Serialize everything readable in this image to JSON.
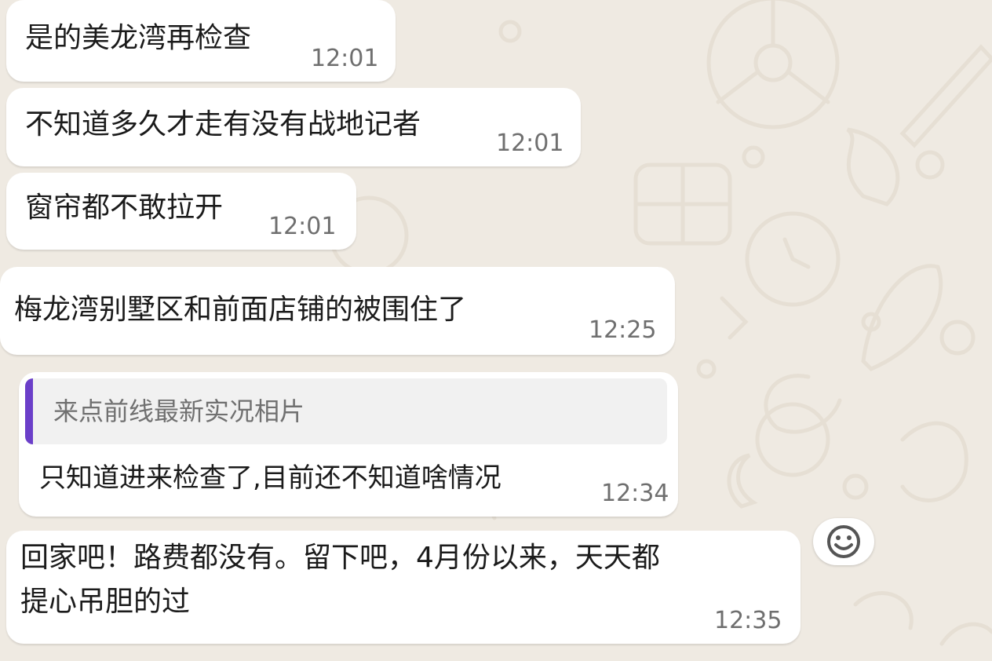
{
  "colors": {
    "chat_background": "#efeae2",
    "bubble_background": "#ffffff",
    "quote_accent": "#6b3fc9",
    "quote_background": "#f1f1f1",
    "time_text": "#6f6f6f"
  },
  "messages": [
    {
      "text": "是的美龙湾再检查",
      "time": "12:01"
    },
    {
      "text": "不知道多久才走有没有战地记者",
      "time": "12:01"
    },
    {
      "text": "窗帘都不敢拉开",
      "time": "12:01"
    },
    {
      "text": "梅龙湾别墅区和前面店铺的被围住了",
      "time": "12:25"
    },
    {
      "quoted_text": "来点前线最新实况相片",
      "text": "只知道进来检查了,目前还不知道啥情况",
      "time": "12:34"
    },
    {
      "text_lines": [
        "回家吧！路费都没有。留下吧，4月份以来，天天都",
        "提心吊胆的过"
      ],
      "time": "12:35"
    }
  ],
  "reaction_button": {
    "icon": "smiley-face-icon"
  }
}
